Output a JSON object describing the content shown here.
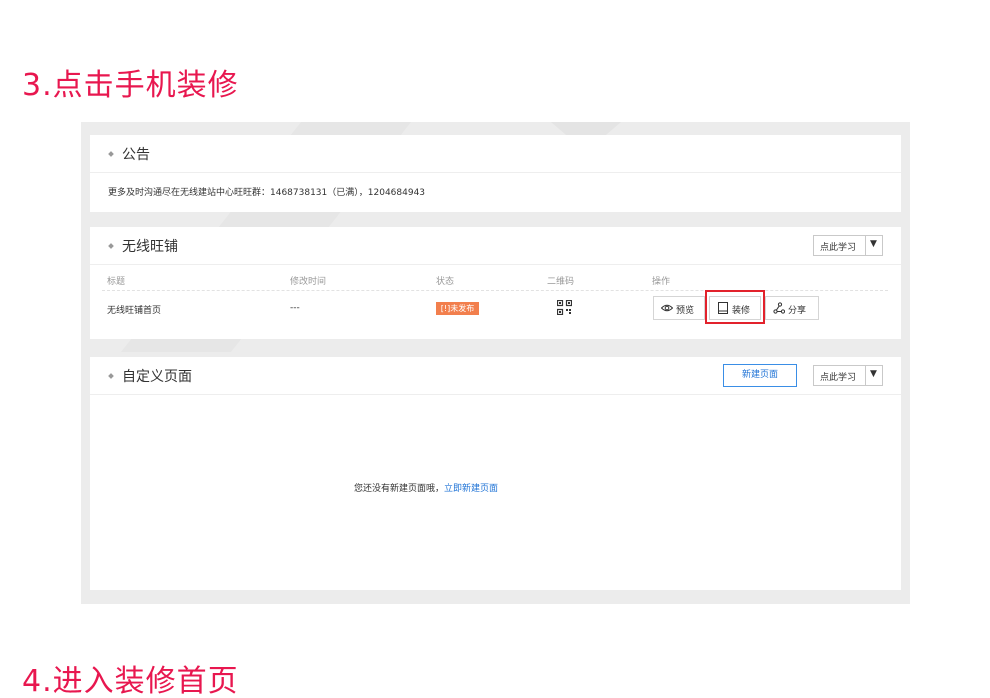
{
  "steps": {
    "step3": "3.点击手机装修",
    "step4": "4.进入装修首页"
  },
  "notice": {
    "title": "公告",
    "text": "更多及时沟通尽在无线建站中心旺旺群：1468738131（已满），1204684943"
  },
  "shop": {
    "title": "无线旺铺",
    "learn_label": "点此学习",
    "dropdown_arrow": "▼",
    "columns": [
      "标题",
      "修改时间",
      "状态",
      "二维码",
      "操作"
    ],
    "row": {
      "title": "无线旺铺首页",
      "modified": "---",
      "status": "[!]未发布",
      "qr_icon": "qr-code-icon"
    },
    "actions": {
      "preview": "预览",
      "decorate": "装修",
      "share": "分享"
    }
  },
  "custom": {
    "title": "自定义页面",
    "new_page_label": "新建页面",
    "learn_label": "点此学习",
    "dropdown_arrow": "▼",
    "empty_text": "您还没有新建页面哦，",
    "empty_link": "立即新建页面"
  },
  "colors": {
    "step_title": "#e8174f",
    "status_badge": "#f27f4d",
    "highlight": "#e2222c",
    "link": "#1f73d6"
  }
}
